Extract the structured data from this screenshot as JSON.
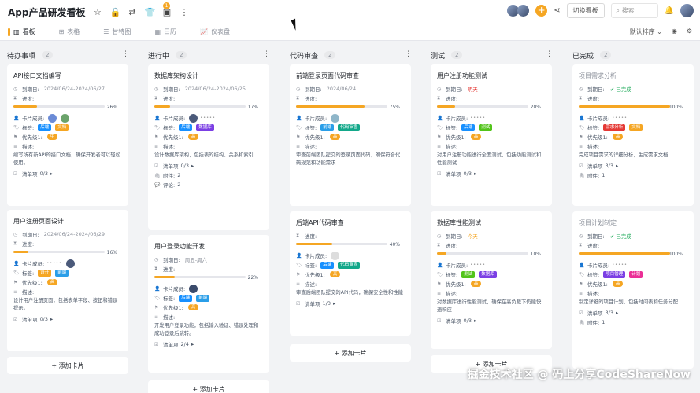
{
  "app": {
    "title": "App产品研发看板",
    "notif_count": "1",
    "switch_board": "切换看板",
    "search_placeholder": "搜索"
  },
  "tabs": [
    {
      "label": "看板",
      "icon": "kanban-icon"
    },
    {
      "label": "表格",
      "icon": "table-icon"
    },
    {
      "label": "甘特图",
      "icon": "gantt-icon"
    },
    {
      "label": "日历",
      "icon": "calendar-icon"
    },
    {
      "label": "仪表盘",
      "icon": "dashboard-icon"
    }
  ],
  "sort_label": "默认排序",
  "labels": {
    "due": "到期日:",
    "progress": "进度:",
    "members": "卡片成员:",
    "tags": "标签:",
    "priority": "优先级1:",
    "desc": "描述:",
    "checklist": "清单项",
    "attachments": "附件:",
    "comments": "评论:"
  },
  "columns": [
    {
      "name": "待办事项",
      "count": "2",
      "add": "添加卡片"
    },
    {
      "name": "进行中",
      "count": "2",
      "add": "添加卡片"
    },
    {
      "name": "代码审查",
      "count": "2",
      "add": "添加卡片"
    },
    {
      "name": "测试",
      "count": "2",
      "add": "添加卡片"
    },
    {
      "name": "已完成",
      "count": "2",
      "add": "添加卡片"
    }
  ],
  "cards": {
    "c1": {
      "title": "API接口文档编写",
      "date": "2024/06/24-2024/06/27",
      "pct": "26%",
      "progress": 0.26,
      "tags": [
        "后端",
        "文档"
      ],
      "prio": "中",
      "desc": "编写所有新API的接口文档，确保开发者可以轻松使用。",
      "check": "0/3"
    },
    "c2": {
      "title": "用户注册页面设计",
      "date": "2024/06/24-2024/06/29",
      "pct": "16%",
      "progress": 0.16,
      "tags": [
        "设计",
        "前端"
      ],
      "prio": "高",
      "desc": "设计用户注册页面，包括表单字段、按钮和错误提示。",
      "check": "0/3"
    },
    "c3": {
      "title": "数据库架构设计",
      "date": "2024/06/24-2024/06/25",
      "pct": "17%",
      "progress": 0.17,
      "tags": [
        "后端",
        "数据库"
      ],
      "prio": "高",
      "desc": "设计数据库架构，包括表的结构、关系和索引",
      "check": "0/3",
      "attach": "2",
      "comments": "2"
    },
    "c4": {
      "title": "用户登录功能开发",
      "date": "周五-周六",
      "pct": "22%",
      "progress": 0.22,
      "tags": [
        "后端",
        "前端"
      ],
      "prio": "高",
      "desc": "开发用户登录功能，包括输入验证、错误处理和成功登录后跳转。",
      "check": "2/4"
    },
    "c5": {
      "title": "前端登录页面代码审查",
      "date": "2024/06/24",
      "pct": "75%",
      "progress": 0.75,
      "tags": [
        "前端",
        "代码审查"
      ],
      "prio": "高",
      "desc": "审查前端团队提交的登录页面代码，确保符合代码规范和功能需求",
      "check": "1/3"
    },
    "c6": {
      "title": "后端API代码审查",
      "pct": "40%",
      "progress": 0.4,
      "tags": [
        "后端",
        "代码审查"
      ],
      "prio": "高",
      "desc": "审查后端团队提交的API代码，确保安全性和性能",
      "check": "1/3"
    },
    "c7": {
      "title": "用户注册功能测试",
      "date": "明天",
      "pct": "20%",
      "progress": 0.2,
      "tags": [
        "后端",
        "测试"
      ],
      "prio": "高",
      "desc": "对用户注册功能进行全面测试，包括功能测试和性能测试",
      "check": "0/3"
    },
    "c8": {
      "title": "数据库性能测试",
      "date": "今天",
      "pct": "10%",
      "progress": 0.1,
      "tags": [
        "测试",
        "数据库"
      ],
      "prio": "高",
      "desc": "对数据库进行性能测试，确保在高负载下仍能快速响应",
      "check": "0/3"
    },
    "c9": {
      "title": "项目需求分析",
      "status": "已完成",
      "pct": "100%",
      "progress": 1.0,
      "tags": [
        "需求分析",
        "文档"
      ],
      "prio": "高",
      "desc": "完成项目需求的详细分析，生成需求文档",
      "check": "3/3",
      "attach": "1"
    },
    "c10": {
      "title": "项目计划制定",
      "status": "已完成",
      "pct": "100%",
      "progress": 1.0,
      "tags": [
        "项目管理",
        "计划"
      ],
      "prio": "高",
      "desc": "制定详细的项目计划，包括时间表和任务分配",
      "check": "3/3",
      "attach": "1"
    }
  },
  "tag_colors": {
    "后端": "#1890ff",
    "文档": "#f5a623",
    "设计": "#f5a623",
    "前端": "#2a9ee8",
    "数据库": "#7b3fe4",
    "代码审查": "#13a88a",
    "测试": "#52c41a",
    "需求分析": "#e53935",
    "项目管理": "#7b3fe4",
    "计划": "#eb2f96"
  },
  "watermark": "掘金技术社区 @ 码上分享CodeShareNow"
}
